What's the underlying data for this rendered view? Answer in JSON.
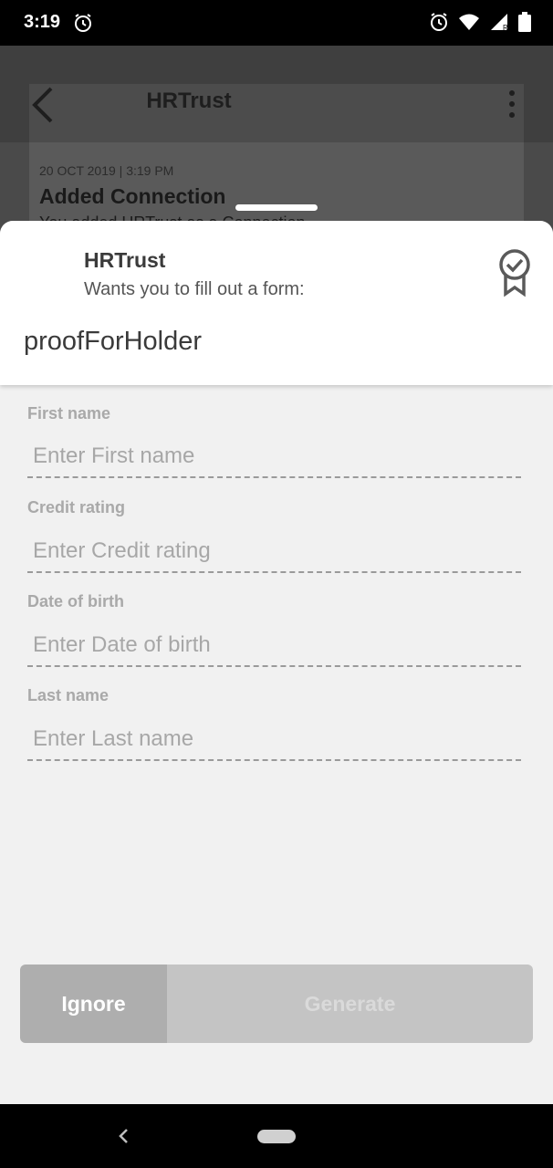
{
  "status_bar": {
    "time": "3:19"
  },
  "background": {
    "app_title": "HRTrust",
    "event_date": "20 OCT 2019 | 3:19 PM",
    "event_title": "Added Connection",
    "event_subtitle": "You added HRTrust as a Connection"
  },
  "sheet": {
    "org_name": "HRTrust",
    "message": "Wants you to fill out a form:",
    "form_name": "proofForHolder",
    "fields": [
      {
        "label": "First name",
        "placeholder": "Enter First name"
      },
      {
        "label": "Credit rating",
        "placeholder": "Enter Credit rating"
      },
      {
        "label": "Date of birth",
        "placeholder": "Enter Date of birth"
      },
      {
        "label": "Last name",
        "placeholder": "Enter Last name"
      }
    ],
    "ignore_label": "Ignore",
    "generate_label": "Generate"
  },
  "colors": {
    "header_bg": "#ffffff",
    "sheet_bg": "#f1f1f1",
    "ignore_bg": "#aeaeae",
    "generate_bg": "#c4c4c4"
  }
}
